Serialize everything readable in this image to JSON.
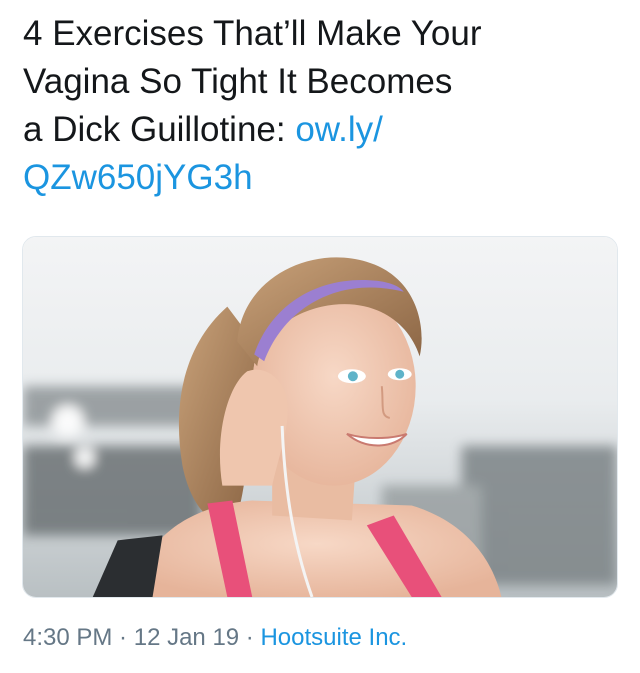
{
  "tweet": {
    "text_line1": "4 Exercises That’ll Make Your",
    "text_line2": "Vagina So Tight It Becomes",
    "text_line3": "a Dick Guillotine: ",
    "link_part1": "ow.ly/",
    "link_part2": "QZw650jYG3h"
  },
  "media": {
    "subject": "woman with purple headband and earphones"
  },
  "meta": {
    "time": "4:30 PM",
    "separator1": " · ",
    "date": "12 Jan 19",
    "separator2": " · ",
    "source": "Hootsuite Inc."
  },
  "colors": {
    "text": "#14171a",
    "link": "#1b95e0",
    "meta": "#657786",
    "headband": "#9b7fd1",
    "top_pink": "#e8507a"
  },
  "icons": {
    "media": "photo-image"
  }
}
